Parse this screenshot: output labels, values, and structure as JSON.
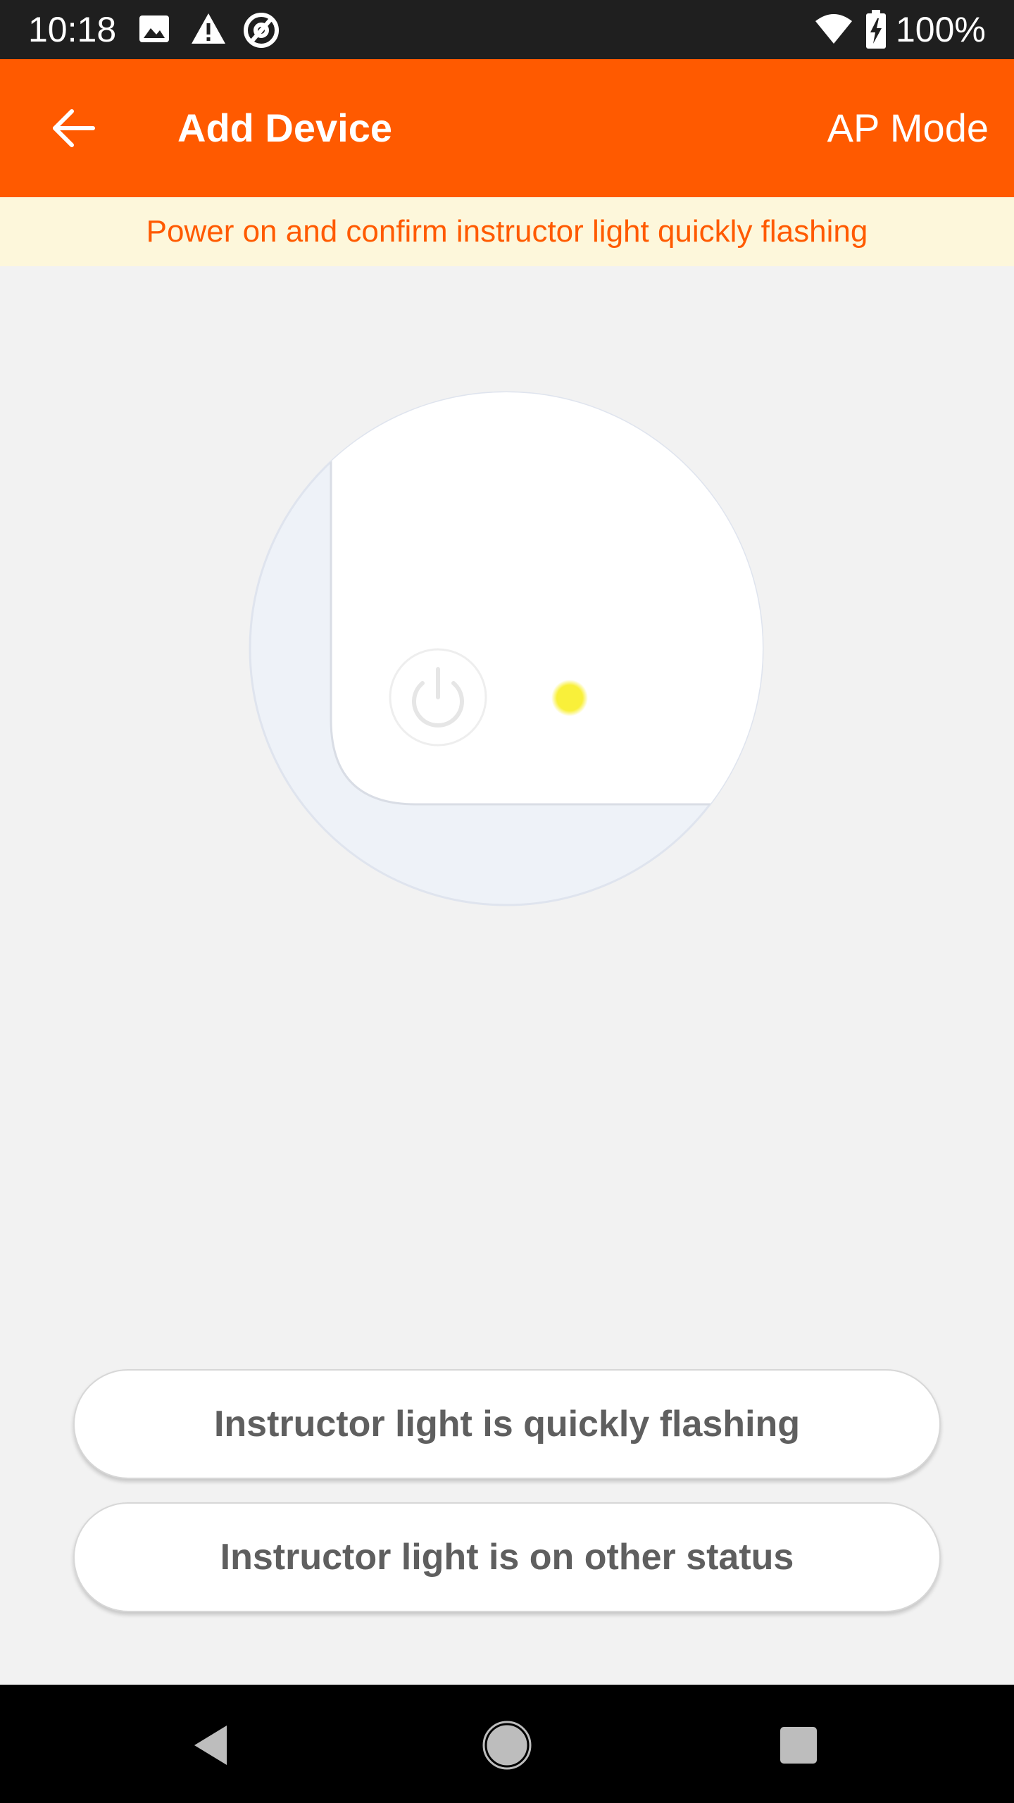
{
  "status_bar": {
    "time": "10:18",
    "battery": "100%",
    "icons": [
      "image-icon",
      "warning-icon",
      "at-sign-icon",
      "wifi-icon",
      "battery-charging-icon"
    ]
  },
  "app_bar": {
    "title": "Add Device",
    "mode_label": "AP Mode",
    "background_color": "#ff5a00"
  },
  "hint": {
    "text": "Power on and confirm instructor light quickly flashing",
    "text_color": "#ff5a00",
    "background_color": "#fdf7db"
  },
  "illustration": {
    "indicator_light_color": "#f9f03a",
    "icons": [
      "power-icon"
    ]
  },
  "actions": {
    "quick_flashing_label": "Instructor light is quickly flashing",
    "other_status_label": "Instructor light is on other status"
  },
  "nav_bar": {
    "icons": [
      "back-triangle-icon",
      "home-circle-icon",
      "recents-square-icon"
    ]
  }
}
